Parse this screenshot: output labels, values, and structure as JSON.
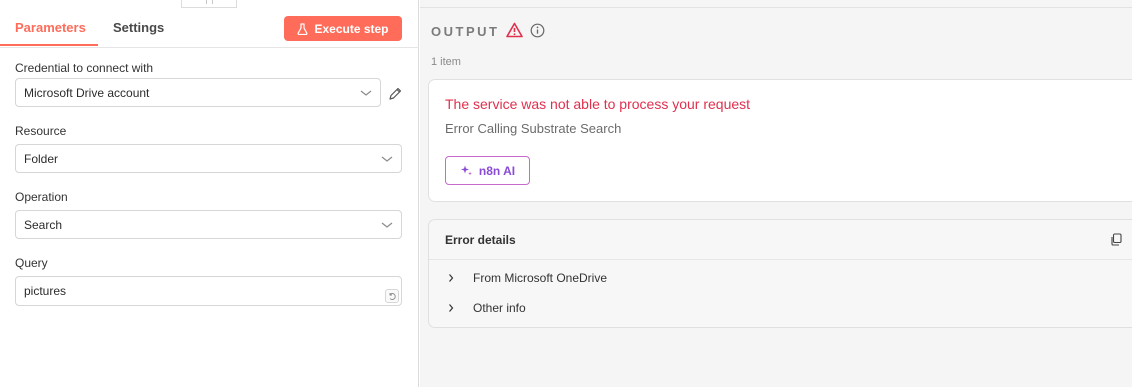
{
  "left_panel": {
    "tabs": [
      {
        "label": "Parameters"
      },
      {
        "label": "Settings"
      }
    ],
    "execute_label": "Execute step",
    "credential": {
      "label": "Credential to connect with",
      "value": "Microsoft Drive account"
    },
    "resource": {
      "label": "Resource",
      "value": "Folder"
    },
    "operation": {
      "label": "Operation",
      "value": "Search"
    },
    "query": {
      "label": "Query",
      "value": "pictures"
    }
  },
  "output": {
    "title": "OUTPUT",
    "items_count": "1 item",
    "error": {
      "title": "The service was not able to process your request",
      "subtitle": "Error Calling Substrate Search",
      "ai_button": "n8n AI"
    },
    "details": {
      "title": "Error details",
      "rows": [
        {
          "label": "From Microsoft OneDrive"
        },
        {
          "label": "Other info"
        }
      ]
    }
  },
  "colors": {
    "accent": "#ff6d5a",
    "error": "#e0304e",
    "ai": "#8a4bd6"
  },
  "icons": [
    "beaker-icon",
    "pencil-icon",
    "chevron-down-icon",
    "expression-icon",
    "warning-icon",
    "info-icon",
    "sparkle-icon",
    "copy-icon",
    "chevron-right-icon"
  ]
}
